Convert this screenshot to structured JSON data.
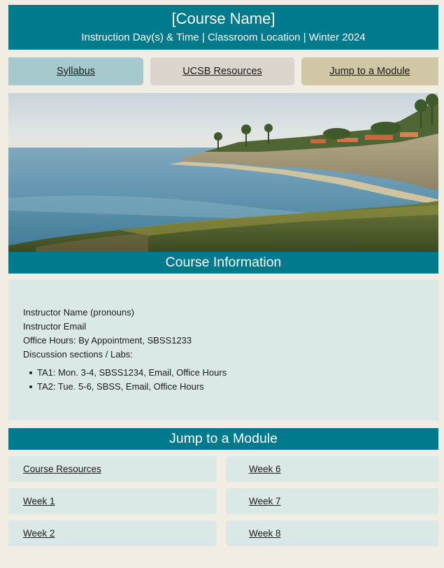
{
  "banner": {
    "title": "[Course Name]",
    "subtitle": "Instruction Day(s) & Time | Classroom Location | Winter 2024"
  },
  "nav": {
    "syllabus": "Syllabus",
    "resources": "UCSB Resources",
    "jump": "Jump to a Module"
  },
  "course_info": {
    "heading": "Course Information",
    "instructor_name": "Instructor Name (pronouns)",
    "instructor_email": "Instructor Email",
    "office_hours": "Office Hours: By Appointment, SBSS1233",
    "sections_label": "Discussion sections / Labs:",
    "sections": [
      "TA1: Mon. 3-4, SBSS1234, Email, Office Hours",
      "TA2: Tue. 5-6, SBSS, Email, Office Hours"
    ]
  },
  "modules": {
    "heading": "Jump to a Module",
    "left": [
      "Course Resources",
      "Week 1",
      "Week 2"
    ],
    "right": [
      "Week 6",
      "Week 7",
      "Week 8"
    ]
  },
  "colors": {
    "teal": "#007a8c",
    "light_teal": "#dbe8e8",
    "background": "#f1ede3"
  }
}
